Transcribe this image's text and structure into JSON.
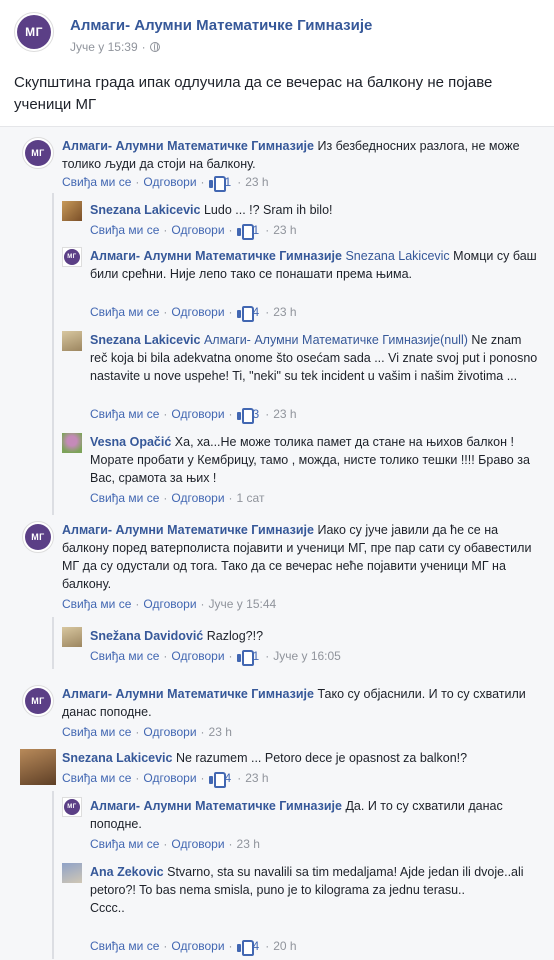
{
  "post": {
    "logo_text": "МГ",
    "page_name": "Алмаги- Алумни Математичке Гимназије",
    "time": "Јуче у 15:39",
    "separator": "·",
    "text": "Скупштина града ипак одлучила да се вечерас на балкону не појаве ученици МГ"
  },
  "labels": {
    "like": "Свиђа ми се",
    "reply": "Одговори",
    "dot": "·"
  },
  "comments": [
    {
      "author": "Алмаги- Алумни Математичке Гимназије",
      "text": "Из безбедносних разлога, не може толико људи да стоји на балкону.",
      "likes": "1",
      "time": "23 h"
    },
    {
      "author": "Snezana Lakicevic",
      "text": "Ludo ... !? Sram ih bilo!",
      "likes": "1",
      "time": "23 h"
    },
    {
      "author": "Алмаги- Алумни Математичке Гимназије",
      "mention": "Snezana Lakicevic",
      "text": "Момци су баш били срећни. Није лепо тако се понашати према њима.",
      "likes": "4",
      "time": "23 h"
    },
    {
      "author": "Snezana Lakicevic",
      "mention": "Алмаги- Алумни Математичке Гимназије(null)",
      "text": "Ne znam reč koja bi bila adekvatna onome što osećam sada ... Vi znate svoj put i ponosno nastavite u nove uspehe! Ti, \"neki\" su tek incident u vašim i našim životima ...",
      "likes": "3",
      "time": "23 h"
    },
    {
      "author": "Vesna Opačić",
      "text": "Ха, ха...Не може толика памет да стане на њихов балкон ! Морате пробати у Кембрицу, тамо , можда, нисте толико тешки !!!! Браво за Вас, срамота за њих !",
      "time": "1 сат"
    },
    {
      "author": "Алмаги- Алумни Математичке Гимназије",
      "text": "Иако су јуче јавили да ће се на балкону поред ватерполиста појавити и ученици МГ, пре пар сати су обавестили МГ да су одустали од тога. Тако да се вечерас неће појавити ученици МГ на балкону.",
      "time": "Јуче у 15:44"
    },
    {
      "author": "Snežana Davidović",
      "text": "Razlog?!?",
      "likes": "1",
      "time": "Јуче у 16:05"
    },
    {
      "author": "Алмаги- Алумни Математичке Гимназије",
      "text": "Тако су објаснили. И то су схватили данас поподне.",
      "time": "23 h"
    },
    {
      "author": "Snezana Lakicevic",
      "text": "Ne razumem ... Petoro dece je opasnost za balkon!?",
      "likes": "4",
      "time": "23 h"
    },
    {
      "author": "Алмаги- Алумни Математичке Гимназије",
      "text": "Да. И то су схватили данас поподне.",
      "time": "23 h"
    },
    {
      "author": "Ana Zekovic",
      "text": "Stvarno, sta su navalili sa tim medaljama! Ajde jedan ili dvoje..ali petoro?! To bas nema smisla, puno je to kilograma za jednu terasu..",
      "text2": "Cccc..",
      "likes": "4",
      "time": "20 h"
    }
  ]
}
